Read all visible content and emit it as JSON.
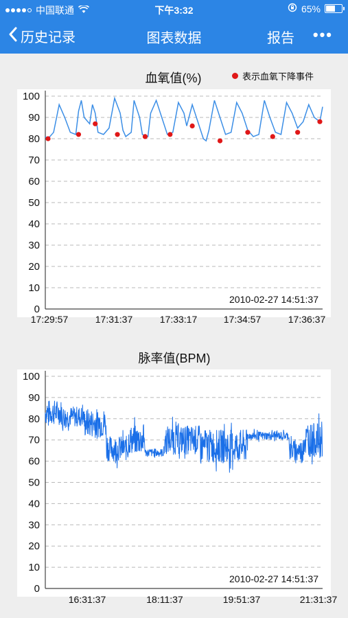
{
  "status_bar": {
    "carrier": "中国联通",
    "time": "下午3:32",
    "battery": "65%",
    "battery_level": 0.65
  },
  "nav": {
    "back_label": "历史记录",
    "title": "图表数据",
    "report_label": "报告",
    "more_label": "•••"
  },
  "spo2": {
    "title": "血氧值(%)",
    "legend_label": "表示血氧下降事件",
    "timestamp": "2010-02-27 14:51:37",
    "x_ticks": [
      "17:29:57",
      "17:31:37",
      "17:33:17",
      "17:34:57",
      "17:36:37"
    ]
  },
  "pulse": {
    "title": "脉率值(BPM)",
    "timestamp": "2010-02-27 14:51:37",
    "x_ticks": [
      "16:31:37",
      "18:11:37",
      "19:51:37",
      "21:31:37"
    ]
  },
  "chart_data": [
    {
      "type": "line",
      "title": "血氧值(%)",
      "ylim": [
        0,
        100
      ],
      "y_ticks": [
        0,
        10,
        20,
        30,
        40,
        50,
        60,
        70,
        80,
        90,
        100
      ],
      "x_tick_labels": [
        "17:29:57",
        "17:31:37",
        "17:33:17",
        "17:34:57",
        "17:36:37"
      ],
      "grid": true,
      "line_color": "#3b8ee6",
      "marker_color": "#e01818",
      "series": [
        {
          "x": [
            0,
            0.01,
            0.03,
            0.05,
            0.07,
            0.09,
            0.11,
            0.12,
            0.13,
            0.14,
            0.16,
            0.17,
            0.18,
            0.19,
            0.21,
            0.23,
            0.25,
            0.27,
            0.28,
            0.29,
            0.31,
            0.32,
            0.34,
            0.35,
            0.37,
            0.38,
            0.4,
            0.42,
            0.44,
            0.46,
            0.48,
            0.5,
            0.51,
            0.53,
            0.55,
            0.57,
            0.58,
            0.59,
            0.61,
            0.63,
            0.65,
            0.67,
            0.69,
            0.71,
            0.73,
            0.75,
            0.77,
            0.79,
            0.81,
            0.83,
            0.85,
            0.87,
            0.89,
            0.91,
            0.93,
            0.95,
            0.97,
            0.99,
            1.0
          ],
          "values": [
            81,
            80,
            83,
            96,
            90,
            83,
            82,
            93,
            98,
            90,
            87,
            96,
            92,
            83,
            82,
            85,
            99,
            92,
            84,
            81,
            83,
            98,
            90,
            82,
            81,
            92,
            98,
            90,
            82,
            83,
            97,
            92,
            86,
            96,
            88,
            80,
            79,
            84,
            98,
            90,
            82,
            83,
            97,
            92,
            84,
            81,
            82,
            98,
            90,
            83,
            82,
            97,
            92,
            85,
            88,
            96,
            90,
            88,
            95
          ]
        }
      ],
      "events": {
        "x": [
          0.01,
          0.12,
          0.18,
          0.26,
          0.36,
          0.45,
          0.53,
          0.63,
          0.73,
          0.82,
          0.91,
          0.99
        ],
        "values": [
          80,
          82,
          87,
          82,
          81,
          82,
          86,
          79,
          83,
          81,
          83,
          88
        ]
      }
    },
    {
      "type": "line",
      "title": "脉率值(BPM)",
      "ylim": [
        0,
        100
      ],
      "y_ticks": [
        0,
        10,
        20,
        30,
        40,
        50,
        60,
        70,
        80,
        90,
        100
      ],
      "x_tick_labels": [
        "16:31:37",
        "18:11:37",
        "19:51:37",
        "21:31:37"
      ],
      "grid": true,
      "line_color": "#1a6fe8",
      "segments": [
        {
          "x": [
            0.0,
            0.06
          ],
          "base": 83,
          "amp": 6
        },
        {
          "x": [
            0.06,
            0.14
          ],
          "base": 81,
          "amp": 5
        },
        {
          "x": [
            0.14,
            0.22
          ],
          "base": 78,
          "amp": 7
        },
        {
          "x": [
            0.22,
            0.3
          ],
          "base": 66,
          "amp": 6
        },
        {
          "x": [
            0.3,
            0.36
          ],
          "base": 70,
          "amp": 7
        },
        {
          "x": [
            0.36,
            0.43
          ],
          "base": 64,
          "amp": 2
        },
        {
          "x": [
            0.43,
            0.56
          ],
          "base": 70,
          "amp": 7
        },
        {
          "x": [
            0.56,
            0.73
          ],
          "base": 67,
          "amp": 8
        },
        {
          "x": [
            0.73,
            0.88
          ],
          "base": 72,
          "amp": 2
        },
        {
          "x": [
            0.88,
            0.93
          ],
          "base": 65,
          "amp": 5
        },
        {
          "x": [
            0.93,
            1.0
          ],
          "base": 70,
          "amp": 8
        }
      ]
    }
  ]
}
